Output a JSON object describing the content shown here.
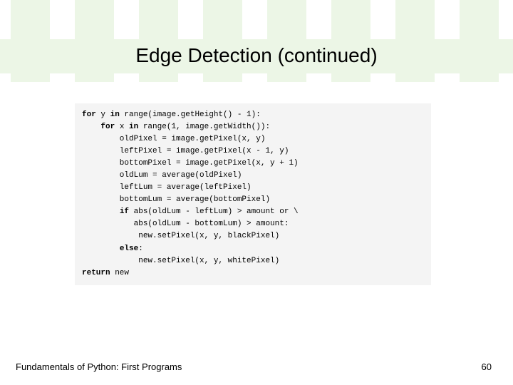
{
  "slide": {
    "title": "Edge Detection (continued)",
    "footer_text": "Fundamentals of Python: First Programs",
    "page_number": "60"
  },
  "code": {
    "l01a": "for",
    "l01b": " y ",
    "l01c": "in",
    "l01d": " range(image.getHeight() - 1):",
    "l02a": "    ",
    "l02b": "for",
    "l02c": " x ",
    "l02d": "in",
    "l02e": " range(1, image.getWidth()):",
    "l03": "        oldPixel = image.getPixel(x, y)",
    "l04": "        leftPixel = image.getPixel(x - 1, y)",
    "l05": "        bottomPixel = image.getPixel(x, y + 1)",
    "l06": "        oldLum = average(oldPixel)",
    "l07": "        leftLum = average(leftPixel)",
    "l08": "        bottomLum = average(bottomPixel)",
    "l09a": "        ",
    "l09b": "if",
    "l09c": " abs(oldLum - leftLum) > amount or \\",
    "l10": "           abs(oldLum - bottomLum) > amount:",
    "l11": "            new.setPixel(x, y, blackPixel)",
    "l12a": "        ",
    "l12b": "else",
    "l12c": ":",
    "l13": "            new.setPixel(x, y, whitePixel)",
    "l14a": "return",
    "l14b": " new"
  }
}
